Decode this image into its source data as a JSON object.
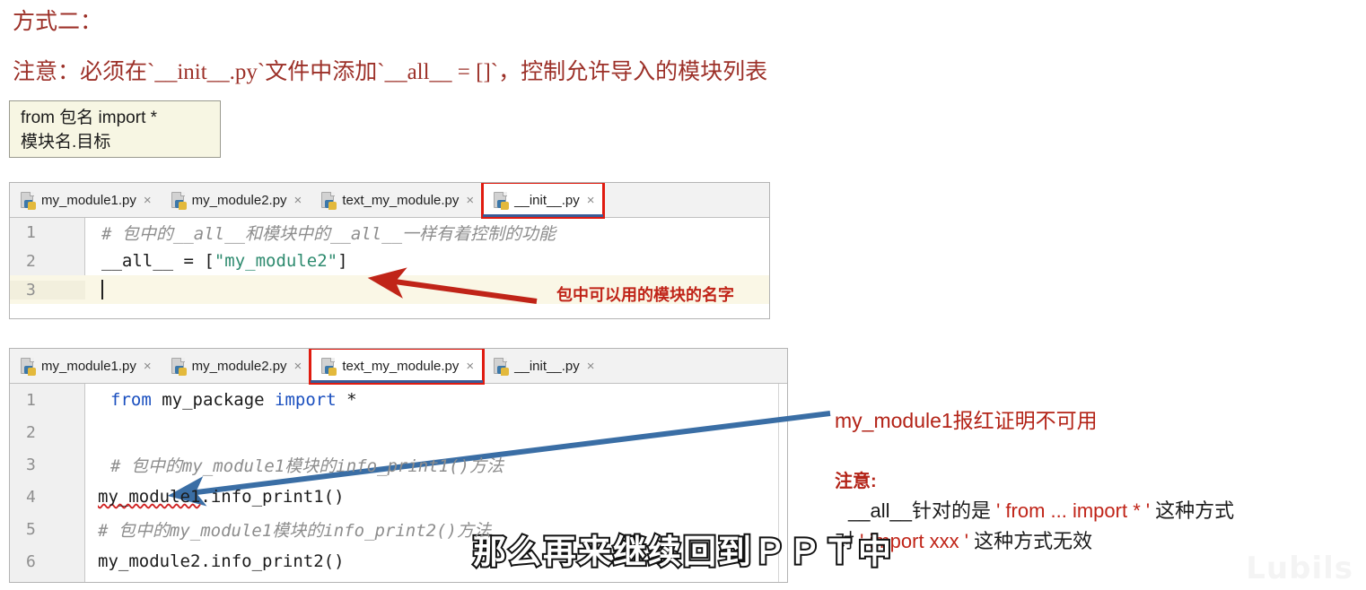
{
  "slide": {
    "title": "方式二：",
    "note": "注意：必须在`__init__.py`文件中添加`__all__ = []`，控制允许导入的模块列表",
    "syntax_box": {
      "line1": "from 包名 import *",
      "line2": "模块名.目标"
    }
  },
  "editor_top": {
    "tabs": [
      {
        "label": "my_module1.py",
        "close": "×",
        "icon": "python-file-icon"
      },
      {
        "label": "my_module2.py",
        "close": "×",
        "icon": "python-file-icon"
      },
      {
        "label": "text_my_module.py",
        "close": "×",
        "icon": "python-file-icon"
      },
      {
        "label": "__init__.py",
        "close": "×",
        "icon": "python-file-icon"
      }
    ],
    "active_tab_index": 3,
    "marked_tab_index": 3,
    "lines": [
      {
        "number": "1",
        "text": "# 包中的__all__和模块中的__all__一样有着控制的功能",
        "kind": "comment"
      },
      {
        "number": "2",
        "prefix": "__all__ = [",
        "string": "\"my_module2\"",
        "suffix": "]",
        "kind": "code"
      },
      {
        "number": "3",
        "text": "",
        "kind": "caret"
      }
    ],
    "annotation": "包中可以用的模块的名字"
  },
  "editor_bottom": {
    "tabs": [
      {
        "label": "my_module1.py",
        "close": "×",
        "icon": "python-file-icon"
      },
      {
        "label": "my_module2.py",
        "close": "×",
        "icon": "python-file-icon"
      },
      {
        "label": "text_my_module.py",
        "close": "×",
        "icon": "python-file-icon"
      },
      {
        "label": "__init__.py",
        "close": "×",
        "icon": "python-file-icon"
      }
    ],
    "active_tab_index": 2,
    "marked_tab_index": 2,
    "lines": [
      {
        "number": "1",
        "kw1": "from",
        "mid": " my_package ",
        "kw2": "import",
        "tail": " *",
        "kind": "import"
      },
      {
        "number": "2",
        "text": "",
        "kind": "blank"
      },
      {
        "number": "3",
        "text": "# 包中的my_module1模块的info_print1()方法",
        "kind": "comment"
      },
      {
        "number": "4",
        "error_token": "my_module1",
        "rest": ".info_print1()",
        "kind": "error-code"
      },
      {
        "number": "5",
        "text": "# 包中的my_module1模块的info_print2()方法",
        "kind": "comment"
      },
      {
        "number": "6",
        "text": "my_module2.info_print2()",
        "kind": "code"
      }
    ]
  },
  "annotations": {
    "module_unavailable": "my_module1报红证明不可用",
    "note_title": "注意:",
    "note_line1_pre": "__all__针对的是 ",
    "note_line1_red": "' from ... import * '",
    "note_line1_post": " 这种方式",
    "note_line2_pre": "对 ",
    "note_line2_red": "' import xxx '",
    "note_line2_post": " 这种方式无效"
  },
  "subtitle": "那么再来继续回到ＰＰＴ中",
  "watermark": "Lubils",
  "colors": {
    "heading_red": "#9c3028",
    "annotation_red": "#c02418",
    "marker_red": "#e01b10",
    "tab_active_underline": "#3a5b96",
    "arrow_blue": "#3a6ea5",
    "syntax_box_bg": "#f7f6e3",
    "current_line": "#faf7e6"
  }
}
